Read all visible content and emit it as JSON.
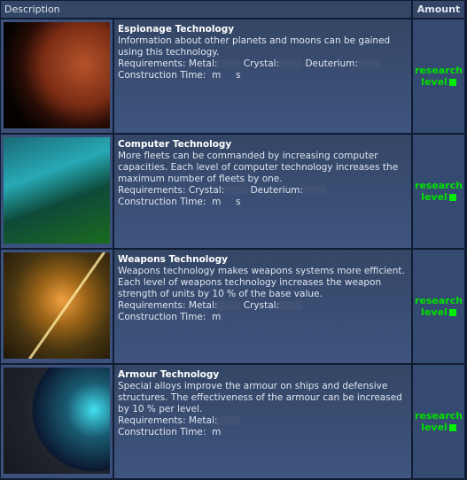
{
  "header": {
    "description": "Description",
    "amount": "Amount"
  },
  "items": [
    {
      "title": "Espionage Technology",
      "description": "Information about other planets and moons can be gained using this technology.",
      "requirements_label": "Requirements:",
      "requirements": [
        "Metal:",
        "Crystal:",
        "Deuterium:"
      ],
      "time_label": "Construction Time:",
      "time_units": [
        "m",
        "s"
      ],
      "action": [
        "research",
        "level"
      ]
    },
    {
      "title": "Computer Technology",
      "description": "More fleets can be commanded by increasing computer capacities. Each level of computer technology increases the maximum number of fleets by one.",
      "requirements_label": "Requirements:",
      "requirements": [
        "Crystal:",
        "Deuterium:"
      ],
      "time_label": "Construction Time:",
      "time_units": [
        "m",
        "s"
      ],
      "action": [
        "research",
        "level"
      ]
    },
    {
      "title": "Weapons Technology",
      "description": "Weapons technology makes weapons systems more efficient. Each level of weapons technology increases the weapon strength of units by 10 % of the base value.",
      "requirements_label": "Requirements:",
      "requirements": [
        "Metal:",
        "Crystal:"
      ],
      "time_label": "Construction Time:",
      "time_units": [
        "m"
      ],
      "action": [
        "research",
        "level"
      ]
    },
    {
      "title": "Armour Technology",
      "description": "Special alloys improve the armour on ships and defensive structures. The effectiveness of the armour can be increased by 10 % per level.",
      "requirements_label": "Requirements:",
      "requirements": [
        "Metal:"
      ],
      "time_label": "Construction Time:",
      "time_units": [
        "m"
      ],
      "action": [
        "research",
        "level"
      ]
    }
  ]
}
